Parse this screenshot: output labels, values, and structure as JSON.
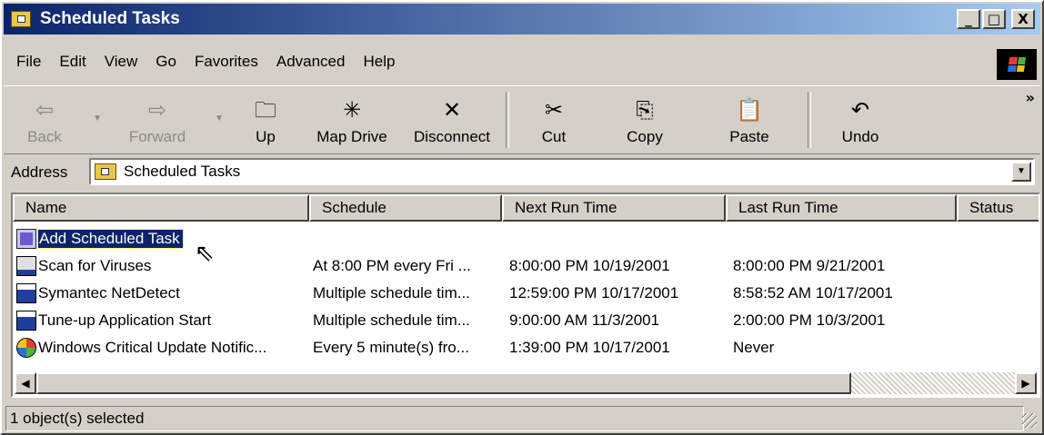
{
  "window": {
    "title": "Scheduled Tasks",
    "min_label": "_",
    "max_label": "□",
    "close_label": "X"
  },
  "menu": [
    "File",
    "Edit",
    "View",
    "Go",
    "Favorites",
    "Advanced",
    "Help"
  ],
  "toolbar": {
    "back": "Back",
    "forward": "Forward",
    "up": "Up",
    "map_drive": "Map Drive",
    "disconnect": "Disconnect",
    "cut": "Cut",
    "copy": "Copy",
    "paste": "Paste",
    "undo": "Undo",
    "more": "»"
  },
  "address": {
    "label": "Address",
    "value": "Scheduled Tasks"
  },
  "columns": [
    "Name",
    "Schedule",
    "Next Run Time",
    "Last Run Time",
    "Status"
  ],
  "rows": [
    {
      "name": "Add Scheduled Task",
      "schedule": "",
      "next": "",
      "last": "",
      "icon": "add-task-icon",
      "selected": true
    },
    {
      "name": "Scan for Viruses",
      "schedule": "At 8:00 PM every Fri ...",
      "next": "8:00:00 PM  10/19/2001",
      "last": "8:00:00 PM  9/21/2001",
      "icon": "scheduled-task-icon"
    },
    {
      "name": "Symantec NetDetect",
      "schedule": "Multiple schedule tim...",
      "next": "12:59:00 PM  10/17/2001",
      "last": "8:58:52 AM  10/17/2001",
      "icon": "scheduled-task-icon"
    },
    {
      "name": "Tune-up Application Start",
      "schedule": "Multiple schedule tim...",
      "next": "9:00:00 AM  11/3/2001",
      "last": "2:00:00 PM  10/3/2001",
      "icon": "scheduled-task-icon"
    },
    {
      "name": "Windows Critical Update Notific...",
      "schedule": "Every 5 minute(s) fro...",
      "next": "1:39:00 PM  10/17/2001",
      "last": "Never",
      "icon": "windows-update-icon"
    }
  ],
  "status": {
    "text": "1 object(s) selected"
  }
}
